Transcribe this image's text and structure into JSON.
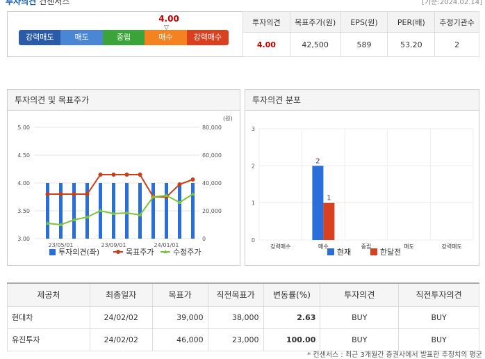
{
  "header": {
    "title": "투자의견",
    "subtitle": "컨센서스",
    "date_note": "[기준:2024.02.14]"
  },
  "opinion": {
    "value": "4.00",
    "marker": "▽",
    "scale": [
      {
        "label": "강력매도",
        "color": "#2a5aa8"
      },
      {
        "label": "매도",
        "color": "#4a86d4"
      },
      {
        "label": "중립",
        "color": "#3aa33a"
      },
      {
        "label": "매수",
        "color": "#f58220"
      },
      {
        "label": "강력매수",
        "color": "#d9401f"
      }
    ]
  },
  "summary": {
    "headers": [
      "투자의견",
      "목표주가(원)",
      "EPS(원)",
      "PER(배)",
      "추정기관수"
    ],
    "values": [
      "4.00",
      "42,500",
      "589",
      "53.20",
      "2"
    ]
  },
  "panels": {
    "left_title": "투자의견 및 목표주가",
    "right_title": "투자의견 분포"
  },
  "chart_data": [
    {
      "type": "bar+line",
      "title": "투자의견 및 목표주가",
      "unit_label": "(원)",
      "x_ticks": [
        "23/05/01",
        "23/09/01",
        "24/01/01"
      ],
      "left_axis": {
        "min": 3.0,
        "max": 5.0,
        "ticks": [
          "3.00",
          "3.50",
          "4.00",
          "4.50",
          "5.00"
        ]
      },
      "right_axis": {
        "min": 0,
        "max": 80000,
        "ticks": [
          "0",
          "20,000",
          "40,000",
          "60,000",
          "80,000"
        ]
      },
      "series": [
        {
          "name": "투자의견(좌)",
          "kind": "bar",
          "color": "#2a6edb",
          "values": [
            4,
            4,
            4,
            4,
            4,
            4,
            4,
            4,
            4,
            4,
            4,
            4
          ]
        },
        {
          "name": "목표주가",
          "kind": "line",
          "color": "#c8401a",
          "values": [
            32000,
            32000,
            32000,
            32000,
            46000,
            46000,
            46000,
            46000,
            30000,
            30000,
            39000,
            42500
          ]
        },
        {
          "name": "수정주가",
          "kind": "line",
          "color": "#7cc43a",
          "values": [
            11000,
            10000,
            13500,
            15500,
            20000,
            18000,
            18500,
            17000,
            30000,
            31000,
            26000,
            32000
          ]
        }
      ],
      "legend": "bottom"
    },
    {
      "type": "bar",
      "title": "투자의견 분포",
      "categories": [
        "강력매수",
        "매수",
        "중립",
        "매도",
        "강력매도"
      ],
      "y_axis": {
        "min": 0,
        "max": 3,
        "ticks": [
          "0",
          "1",
          "2",
          "3"
        ]
      },
      "series": [
        {
          "name": "현재",
          "color": "#2a6edb",
          "values": [
            0,
            2,
            0,
            0,
            0
          ]
        },
        {
          "name": "한달전",
          "color": "#d9401f",
          "values": [
            0,
            1,
            0,
            0,
            0
          ]
        }
      ],
      "data_labels": [
        "2",
        "1"
      ],
      "legend": "bottom"
    }
  ],
  "providers": {
    "headers": [
      "제공처",
      "최종일자",
      "목표가",
      "직전목표가",
      "변동률(%)",
      "투자의견",
      "직전투자의견"
    ],
    "rows": [
      [
        "현대차",
        "24/02/02",
        "39,000",
        "38,000",
        "2.63",
        "BUY",
        "BUY"
      ],
      [
        "유진투자",
        "24/02/02",
        "46,000",
        "23,000",
        "100.00",
        "BUY",
        "BUY"
      ]
    ]
  },
  "footnote": "* 컨센서스 : 최근 3개월간 증권사에서 발표한 추정치의 평균"
}
